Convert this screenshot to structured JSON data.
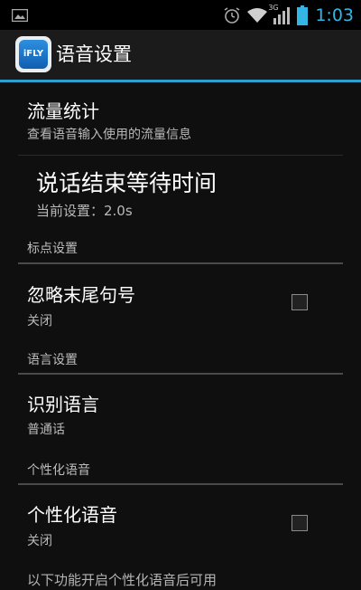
{
  "status_bar": {
    "network": "3G",
    "time": "1:03"
  },
  "action_bar": {
    "icon_text": "iFLY",
    "title": "语音设置"
  },
  "items": {
    "traffic": {
      "title": "流量统计",
      "summary": "查看语音输入使用的流量信息"
    },
    "wait_time": {
      "title": "说话结束等待时间",
      "summary": "当前设置：2.0s"
    },
    "cat_punct": "标点设置",
    "ignore_period": {
      "title": "忽略末尾句号",
      "summary": "关闭",
      "checked": false
    },
    "cat_lang": "语言设置",
    "recognize_lang": {
      "title": "识别语言",
      "summary": "普通话"
    },
    "cat_personal": "个性化语音",
    "personal_voice": {
      "title": "个性化语音",
      "summary": "关闭",
      "checked": false
    },
    "footer_note": "以下功能开启个性化语音后可用"
  }
}
